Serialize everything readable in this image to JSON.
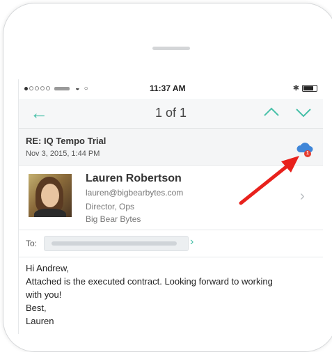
{
  "status_bar": {
    "time": "11:37 AM"
  },
  "nav": {
    "back_icon": "arrow-left-icon",
    "title": "1 of 1",
    "up_icon": "chevron-up-icon",
    "down_icon": "chevron-down-icon",
    "accent_color": "#46c0a8"
  },
  "email": {
    "subject": "RE: IQ Tempo Trial",
    "date": "Nov 3, 2015, 1:44 PM",
    "sync_icon": "cloud-sync-icon",
    "sync_badge": "1",
    "sender": {
      "name": "Lauren Robertson",
      "email": "lauren@bigbearbytes.com",
      "title": "Director, Ops",
      "company": "Big Bear Bytes"
    },
    "to_label": "To:",
    "body_lines": [
      "Hi Andrew,",
      "Attached is the executed contract. Looking forward to working",
      "with you!",
      "Best,",
      "Lauren"
    ]
  },
  "annotation": {
    "arrow_color": "#e8211c"
  }
}
